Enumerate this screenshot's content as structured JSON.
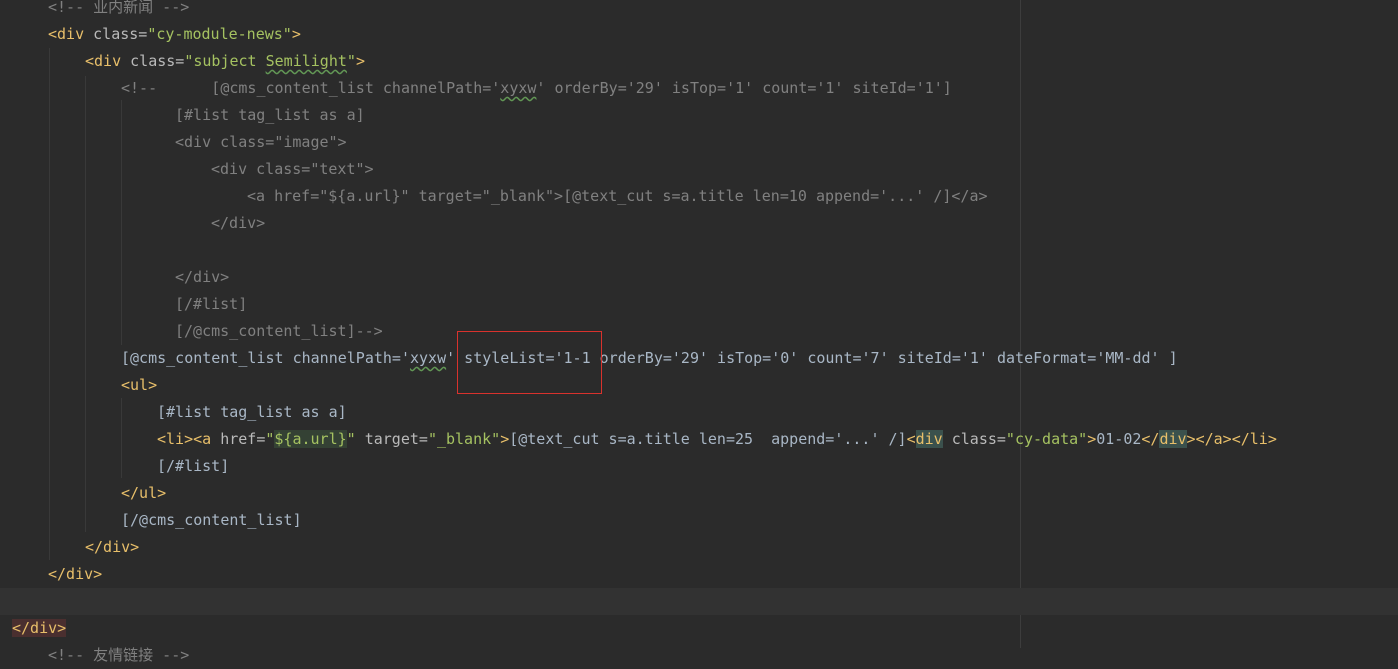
{
  "editor": {
    "lines": [
      {
        "indent": 48,
        "tokens": [
          {
            "t": "<!-- 业内新闻 -->",
            "c": "comment"
          }
        ]
      },
      {
        "indent": 48,
        "tokens": [
          {
            "t": "<div",
            "c": "tag"
          },
          {
            "t": " class=",
            "c": "attr"
          },
          {
            "t": "\"cy-module-news\"",
            "c": "str"
          },
          {
            "t": ">",
            "c": "tag"
          }
        ]
      },
      {
        "indent": 85,
        "tokens": [
          {
            "t": "<div",
            "c": "tag"
          },
          {
            "t": " class=",
            "c": "attr"
          },
          {
            "t": "\"subject ",
            "c": "str"
          },
          {
            "t": "Semilight",
            "c": "str squiggle"
          },
          {
            "t": "\"",
            "c": "str"
          },
          {
            "t": ">",
            "c": "tag"
          }
        ]
      },
      {
        "indent": 121,
        "tokens": [
          {
            "t": "<!--      [@cms_content_list channelPath='",
            "c": "comment"
          },
          {
            "t": "xyxw",
            "c": "comment squiggle"
          },
          {
            "t": "' orderBy='29' isTop='1' count='1' siteId='1']",
            "c": "comment"
          }
        ]
      },
      {
        "indent": 175,
        "tokens": [
          {
            "t": "[#list tag_list as a]",
            "c": "comment"
          }
        ]
      },
      {
        "indent": 175,
        "tokens": [
          {
            "t": "<div class=\"image\">",
            "c": "comment"
          }
        ]
      },
      {
        "indent": 211,
        "tokens": [
          {
            "t": "<div class=\"text\">",
            "c": "comment"
          }
        ]
      },
      {
        "indent": 247,
        "tokens": [
          {
            "t": "<a href=\"${a.url}\" target=\"_blank\">[@text_cut s=a.title len=10 append='...' /]</a>",
            "c": "comment"
          }
        ]
      },
      {
        "indent": 211,
        "tokens": [
          {
            "t": "</div>",
            "c": "comment"
          }
        ]
      },
      {
        "indent": 0,
        "tokens": []
      },
      {
        "indent": 175,
        "tokens": [
          {
            "t": "</div>",
            "c": "comment"
          }
        ]
      },
      {
        "indent": 175,
        "tokens": [
          {
            "t": "[/#list]",
            "c": "comment"
          }
        ]
      },
      {
        "indent": 175,
        "tokens": [
          {
            "t": "[/@cms_content_list]-->",
            "c": "comment"
          }
        ]
      },
      {
        "indent": 121,
        "tokens": [
          {
            "t": "[@cms_content_list channelPath='",
            "c": "ftl"
          },
          {
            "t": "xyxw",
            "c": "ftl squiggle"
          },
          {
            "t": "' styleList='1-1 orderBy='29' isTop='0' count='7' siteId='1' dateFormat='MM-dd' ]",
            "c": "ftl"
          }
        ]
      },
      {
        "indent": 121,
        "tokens": [
          {
            "t": "<ul>",
            "c": "tag"
          }
        ]
      },
      {
        "indent": 157,
        "tokens": [
          {
            "t": "[#list tag_list as a]",
            "c": "ftl"
          }
        ]
      },
      {
        "indent": 157,
        "tokens": [
          {
            "t": "<li>",
            "c": "tag"
          },
          {
            "t": "<a",
            "c": "tag"
          },
          {
            "t": " href=",
            "c": "attr"
          },
          {
            "t": "\"",
            "c": "str"
          },
          {
            "t": "${a.url}",
            "c": "str hl-str"
          },
          {
            "t": "\"",
            "c": "str"
          },
          {
            "t": " target=",
            "c": "attr"
          },
          {
            "t": "\"_blank\"",
            "c": "str"
          },
          {
            "t": ">",
            "c": "tag"
          },
          {
            "t": "[@text_cut s=a.title len=25  append='...' /]",
            "c": "plain"
          },
          {
            "t": "<",
            "c": "tag"
          },
          {
            "t": "div",
            "c": "tag hl-tag"
          },
          {
            "t": " class=",
            "c": "attr"
          },
          {
            "t": "\"cy-data\"",
            "c": "str"
          },
          {
            "t": ">",
            "c": "tag"
          },
          {
            "t": "01-02",
            "c": "plain"
          },
          {
            "t": "</",
            "c": "tag"
          },
          {
            "t": "div",
            "c": "tag hl-tag"
          },
          {
            "t": ">",
            "c": "tag"
          },
          {
            "t": "</a>",
            "c": "tag"
          },
          {
            "t": "</li>",
            "c": "tag"
          }
        ]
      },
      {
        "indent": 157,
        "tokens": [
          {
            "t": "[/#list]",
            "c": "ftl"
          }
        ]
      },
      {
        "indent": 121,
        "tokens": [
          {
            "t": "</ul>",
            "c": "tag"
          }
        ]
      },
      {
        "indent": 121,
        "tokens": [
          {
            "t": "[/@cms_content_list]",
            "c": "ftl"
          }
        ]
      },
      {
        "indent": 85,
        "tokens": [
          {
            "t": "</div>",
            "c": "tag"
          }
        ]
      },
      {
        "indent": 48,
        "tokens": [
          {
            "t": "</div>",
            "c": "tag"
          }
        ]
      },
      {
        "indent": 0,
        "tokens": [],
        "current": true
      },
      {
        "indent": 12,
        "tokens": [
          {
            "t": "</div>",
            "c": "tag err-tag"
          }
        ]
      },
      {
        "indent": 48,
        "tokens": [
          {
            "t": "<!-- 友情链接 -->",
            "c": "comment"
          }
        ]
      }
    ]
  }
}
